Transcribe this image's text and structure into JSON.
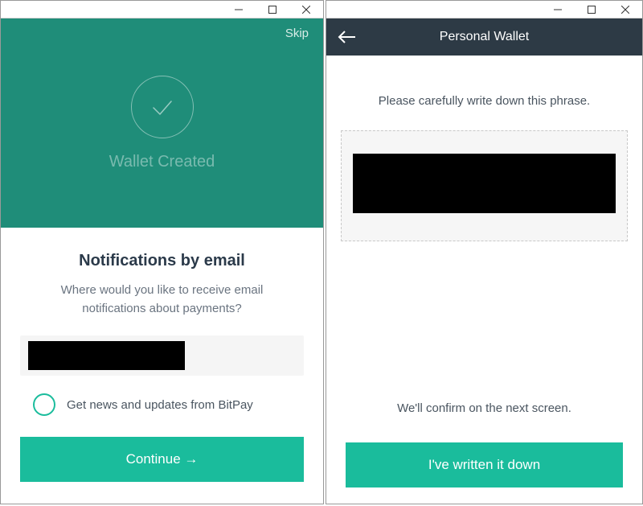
{
  "left": {
    "skip": "Skip",
    "hero_title": "Wallet Created",
    "section_title": "Notifications by email",
    "section_sub": "Where would you like to receive email notifications about payments?",
    "email_value": "",
    "checkbox_label": "Get news and updates from BitPay",
    "continue_label": "Continue →"
  },
  "right": {
    "nav_title": "Personal Wallet",
    "instruction": "Please carefully write down this phrase.",
    "confirm_text": "We'll confirm on the next screen.",
    "done_label": "I've written it down"
  }
}
